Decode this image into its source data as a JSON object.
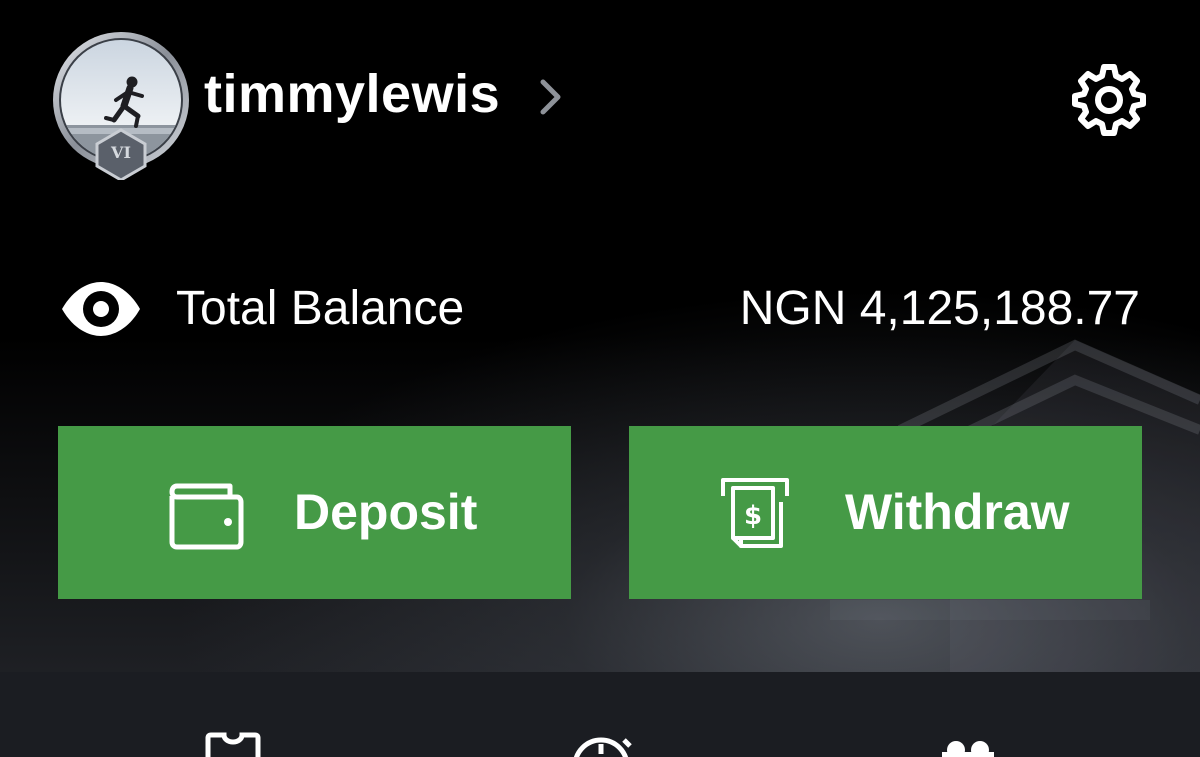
{
  "header": {
    "username": "timmylewis",
    "level_badge": "VI",
    "avatar_icon": "runner-avatar",
    "chevron_icon": "chevron-right-icon",
    "settings_icon": "gear-icon"
  },
  "balance": {
    "visibility_icon": "eye-icon",
    "label": "Total Balance",
    "value": "NGN 4,125,188.77"
  },
  "actions": {
    "deposit": {
      "label": "Deposit",
      "icon": "wallet-icon"
    },
    "withdraw": {
      "label": "Withdraw",
      "icon": "cash-withdraw-icon"
    }
  },
  "bottom_nav": {
    "icons": [
      "ticket-icon",
      "timer-icon",
      "gift-icon"
    ]
  },
  "colors": {
    "background": "#000000",
    "button": "#459a46",
    "text": "#ffffff",
    "panel": "#1b1d22"
  }
}
